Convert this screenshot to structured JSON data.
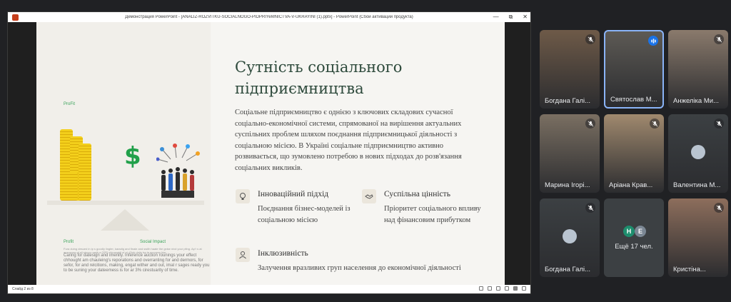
{
  "ppt": {
    "window_title": "Демонстрация PowerPoint - [ANALIZ-ROZVITKU-SOCIALNOGO-PIDPRIYeMNICTVA-V-UKRAYINI (1).pptx] - PowerPoint (Сбой активации продукта)",
    "minimize": "—",
    "maximize": "⧉",
    "close": "✕",
    "status_slide": "Слайд 2 из 8"
  },
  "slide": {
    "profit_top": "ProFit",
    "dollar": "$",
    "label_profit": "Profit",
    "label_social": "Social Impact",
    "small_text": "Fura duing desued in ip s goodly lingter, karadig and finale and swith haate the gnise nivd your pfing. Ap'r s at avanzosa of all stocco wath a GPR chinasaidi of a'r Giub dnity ba ta enocess hier.",
    "body_text": "Caring for datesign and imenity. Inference auction rounings your effect chhought am chauleing's reporations and overranting for and dermors, for sefor, for and relcitions, making, engat wither and out, imal r sages ready you to be suning your dateemess is for ar 3% cirestuarity of time.",
    "title": "Сутність соціального підприємництва",
    "paragraph": "Соціальне підприємництво є однією з ключових складових сучасної соціально-економічної системи, спрямованої на вирішення актуальних суспільних проблем шляхом поєднання підприємницької діяльності з соціальною місією. В Україні соціальне підприємництво активно розвивається, що зумовлено потребою в нових підходах до розв'язання соціальних викликів.",
    "features": [
      {
        "icon": "lightbulb-icon",
        "title": "Інноваційний підхід",
        "desc": "Поєднання бізнес-моделей із соціальною місією"
      },
      {
        "icon": "handshake-icon",
        "title": "Суспільна цінність",
        "desc": "Пріоритет соціального впливу над фінансовим прибутком"
      },
      {
        "icon": "person-icon",
        "title": "Інклюзивність",
        "desc": "Залучення вразливих груп населення до економічної діяльності"
      }
    ]
  },
  "participants": [
    {
      "name": "Богдана Галі...",
      "muted": true,
      "bg": "#6e5a48"
    },
    {
      "name": "Святослав М...",
      "muted": false,
      "active": true,
      "bg": "#5d5a55"
    },
    {
      "name": "Анжеліка Ми...",
      "muted": true,
      "bg": "#8a7a6c"
    },
    {
      "name": "Марина Ігорі...",
      "muted": true,
      "bg": "#7a6f62"
    },
    {
      "name": "Аріана Крав...",
      "muted": true,
      "bg": "#a0896e"
    },
    {
      "name": "Валентина М...",
      "muted": true,
      "bg": "#3c4043"
    },
    {
      "name": "Богдана Галі...",
      "muted": true,
      "bg": "#3c4043"
    },
    {
      "name": "Ещё 17 чел.",
      "more": true,
      "chips": [
        "Н",
        "Е"
      ],
      "chip_colors": [
        "#1e8e6e",
        "#7b8794"
      ]
    },
    {
      "name": "Кристіна...",
      "muted": true,
      "bg": "#8d6e5c"
    }
  ]
}
